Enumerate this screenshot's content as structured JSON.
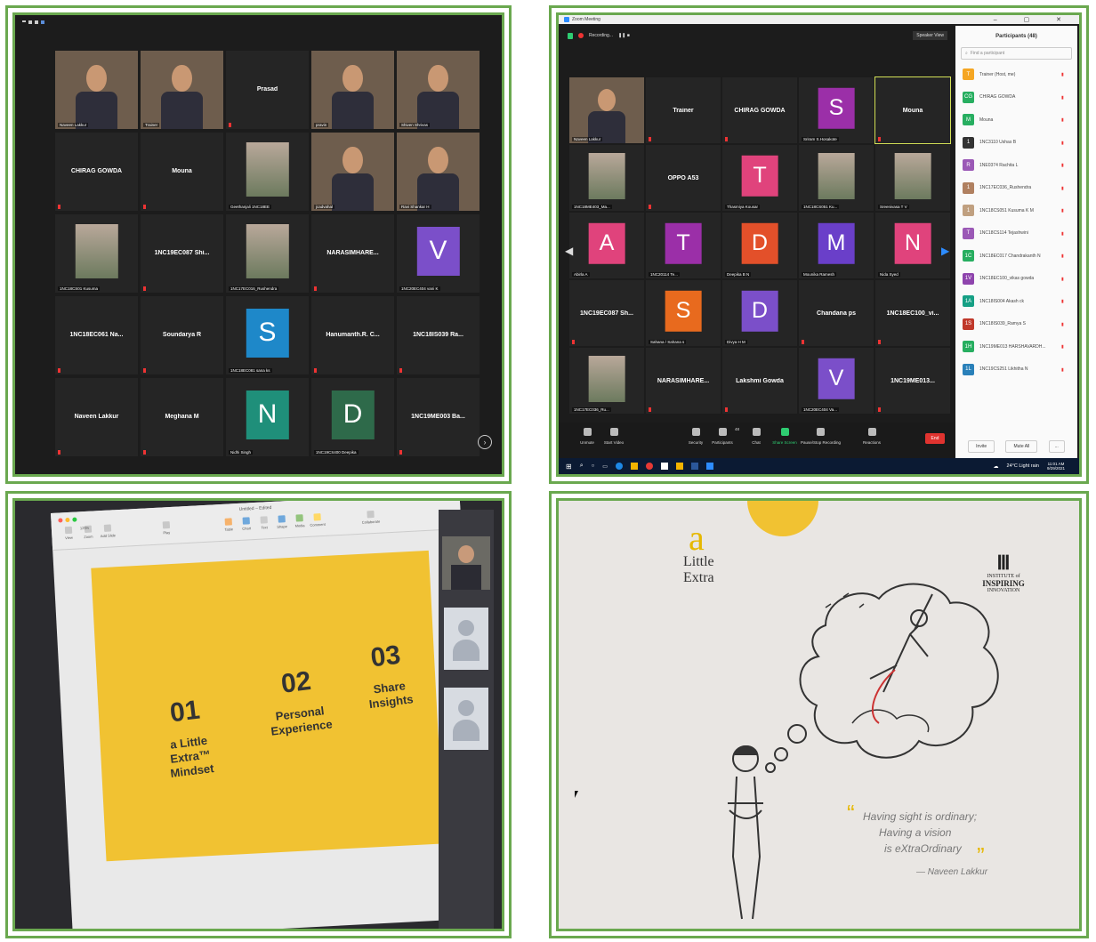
{
  "colors": {
    "frame_green": "#6aa84f",
    "zoom_dark": "#1c1c1c",
    "tile": "#252525",
    "slide_yellow": "#f1c232",
    "end_red": "#e0332f"
  },
  "panel1": {
    "tiles": [
      {
        "name": "",
        "cap": "Naveen Lakkur",
        "type": "video"
      },
      {
        "name": "",
        "cap": "Trainer",
        "type": "video"
      },
      {
        "name": "Prasad",
        "cap": ""
      },
      {
        "name": "",
        "cap": "pravin",
        "type": "video"
      },
      {
        "name": "",
        "cap": "Shiven Shrivas",
        "type": "video"
      },
      {
        "name": "CHIRAG GOWDA",
        "cap": ""
      },
      {
        "name": "Mouna",
        "cap": ""
      },
      {
        "name": "",
        "cap": "Geethanjali 1NC18EE",
        "type": "photo"
      },
      {
        "name": "",
        "cap": "jcadvahal",
        "type": "video"
      },
      {
        "name": "",
        "cap": "Ravi Shankar H",
        "type": "video"
      },
      {
        "name": "",
        "cap": "1NC18CS01 Kusuma",
        "type": "photo"
      },
      {
        "name": "1NC19EC087 Shi...",
        "cap": ""
      },
      {
        "name": "",
        "cap": "1NC17EC016_Rushendra",
        "type": "photo"
      },
      {
        "name": "NARASIMHARE...",
        "cap": ""
      },
      {
        "name": "",
        "cap": "1NC20EC404 vani K",
        "letter": "V",
        "color": "#7b4fc9"
      },
      {
        "name": "1NC18EC061 Na...",
        "cap": ""
      },
      {
        "name": "Soundarya R",
        "cap": ""
      },
      {
        "name": "",
        "cap": "1NC18EC081 sana ks",
        "letter": "S",
        "color": "#1e88c9"
      },
      {
        "name": "Hanumanth.R. C...",
        "cap": ""
      },
      {
        "name": "1NC18IS039 Ra...",
        "cap": ""
      },
      {
        "name": "Naveen Lakkur",
        "cap": ""
      },
      {
        "name": "Meghana M",
        "cap": ""
      },
      {
        "name": "",
        "cap": "Nidhi Singh",
        "letter": "N",
        "color": "#1f8f7a"
      },
      {
        "name": "",
        "cap": "1NC19CS400 Deepika",
        "letter": "D",
        "color": "#2e6a4a"
      },
      {
        "name": "1NC19ME003 Ba...",
        "cap": ""
      }
    ]
  },
  "panel2": {
    "window_title": "Zoom Meeting",
    "recording": "Recording...",
    "speaker_view": "Speaker View",
    "tiles": [
      {
        "name": "",
        "cap": "Naveen Lakkur",
        "type": "video"
      },
      {
        "name": "Trainer",
        "cap": ""
      },
      {
        "name": "CHIRAG GOWDA",
        "cap": ""
      },
      {
        "name": "",
        "cap": "Sriram S.Hosakote",
        "letter": "S",
        "color": "#9b2fa8"
      },
      {
        "name": "Mouna",
        "cap": "",
        "active": true
      },
      {
        "name": "",
        "cap": "1NC18ME403_Ma...",
        "type": "photo"
      },
      {
        "name": "OPPO A53",
        "cap": ""
      },
      {
        "name": "",
        "cap": "Thasmiya Kousar",
        "letter": "T",
        "color": "#e0437c"
      },
      {
        "name": "",
        "cap": "1NC18CS051 Ku...",
        "type": "photo"
      },
      {
        "name": "",
        "cap": "Sreenivasa T V",
        "type": "photo"
      },
      {
        "name": "",
        "cap": "Abirla A",
        "letter": "A",
        "color": "#e0437c"
      },
      {
        "name": "",
        "cap": "1NC20114 Te...",
        "letter": "T",
        "color": "#9b2fa8"
      },
      {
        "name": "",
        "cap": "Deepika B N",
        "letter": "D",
        "color": "#e3502a"
      },
      {
        "name": "",
        "cap": "Mounika Ramesh",
        "letter": "M",
        "color": "#6a3fc9"
      },
      {
        "name": "",
        "cap": "Nida Syed",
        "letter": "N",
        "color": "#e0437c"
      },
      {
        "name": "1NC19EC087 Sh...",
        "cap": ""
      },
      {
        "name": "",
        "cap": "Sahana / Sahana s",
        "letter": "S",
        "color": "#e86a1e"
      },
      {
        "name": "",
        "cap": "Divya H M",
        "letter": "D",
        "color": "#7b4fc9"
      },
      {
        "name": "Chandana ps",
        "cap": ""
      },
      {
        "name": "1NC18EC100_vi...",
        "cap": ""
      },
      {
        "name": "",
        "cap": "1NC17EC036_Ru...",
        "type": "photo"
      },
      {
        "name": "NARASIMHARE...",
        "cap": ""
      },
      {
        "name": "Lakshmi Gowda",
        "cap": ""
      },
      {
        "name": "",
        "cap": "1NC20EC404 Va...",
        "letter": "V",
        "color": "#7b4fc9"
      },
      {
        "name": "1NC19ME013...",
        "cap": ""
      }
    ],
    "participants_title": "Participants (48)",
    "find_placeholder": "Find a participant",
    "participants": [
      {
        "badge": "T",
        "color": "#f5a623",
        "name": "Trainer (Host, me)"
      },
      {
        "badge": "CG",
        "color": "#27ae60",
        "name": "CHIRAG GOWDA"
      },
      {
        "badge": "M",
        "color": "#27ae60",
        "name": "Mouna"
      },
      {
        "badge": "1",
        "color": "#333",
        "name": "1NC3110 Ushas B"
      },
      {
        "badge": "R",
        "color": "#9b59b6",
        "name": "1NE0374 Rachita L"
      },
      {
        "badge": "1",
        "color": "#b08060",
        "name": "1NC17EC036_Rushendra"
      },
      {
        "badge": "1",
        "color": "#c0a080",
        "name": "1NC18CS051 Kusuma K M"
      },
      {
        "badge": "T",
        "color": "#9b59b6",
        "name": "1NC18CS114 Tejashwini"
      },
      {
        "badge": "1C",
        "color": "#27ae60",
        "name": "1NC18EC017 Chandrakanth N"
      },
      {
        "badge": "1V",
        "color": "#8e44ad",
        "name": "1NC18EC100_vikas gowda"
      },
      {
        "badge": "1A",
        "color": "#16a085",
        "name": "1NC18IS004 Akash ck"
      },
      {
        "badge": "1S",
        "color": "#c0392b",
        "name": "1NC18IS039_Ramya S"
      },
      {
        "badge": "1H",
        "color": "#27ae60",
        "name": "1NC19ME013 HARSHAVARDH..."
      },
      {
        "badge": "1L",
        "color": "#2980b9",
        "name": "1NC19CS251 Likhitha N"
      }
    ],
    "invite": "Invite",
    "mute_all": "Mute All",
    "more": "...",
    "toolbar": [
      "Unmute",
      "Start Video",
      "Security",
      "Participants",
      "Chat",
      "Share Screen",
      "Pause/Stop Recording",
      "Reactions"
    ],
    "participants_count": "48",
    "end": "End",
    "weather": "24°C Light rain",
    "time": "11:01 AM",
    "date": "9/29/2021"
  },
  "panel3": {
    "window_title": "Untitled – Edited",
    "toolbar": [
      "View",
      "Zoom",
      "Add Slide",
      "Play",
      "Table",
      "Chart",
      "Text",
      "Shape",
      "Media",
      "Comment",
      "Collaborate"
    ],
    "zoom": "125%",
    "items": [
      {
        "num": "01",
        "label": "a Little Extra™ Mindset"
      },
      {
        "num": "02",
        "label": "Personal Experience"
      },
      {
        "num": "03",
        "label": "Share Insights"
      }
    ]
  },
  "panel4": {
    "logo_a": "a",
    "logo_little": "Little",
    "logo_extra": "Extra",
    "institute_line1": "INSTITUTE of",
    "institute_line2": "INSPIRING",
    "institute_line3": "INNOVATION",
    "quote_line1": "Having sight is ordinary;",
    "quote_line2": "Having a vision",
    "quote_line3": "is eXtraOrdinary",
    "author": "— Naveen Lakkur"
  }
}
